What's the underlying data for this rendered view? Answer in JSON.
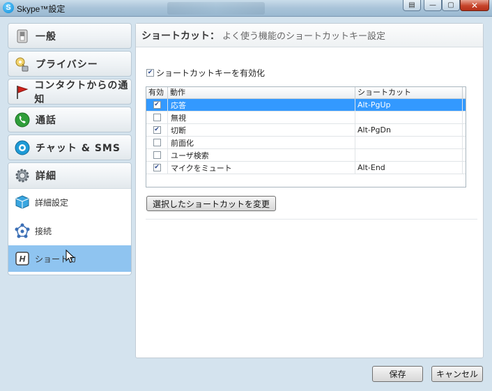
{
  "window": {
    "title": "Skype™設定",
    "app_icon_letter": "S",
    "controls": {
      "help": "▤",
      "minimize": "—",
      "maximize": "▢",
      "close": "✕"
    }
  },
  "sidebar": {
    "items": [
      {
        "label": "一般",
        "icon": "switch-icon"
      },
      {
        "label": "プライバシー",
        "icon": "key-lock-icon"
      },
      {
        "label": "コンタクトからの通知",
        "icon": "flag-icon"
      },
      {
        "label": "通話",
        "icon": "phone-icon"
      },
      {
        "label": "チャット & SMS",
        "icon": "chat-icon"
      }
    ],
    "open_section": {
      "label": "詳細",
      "icon": "gear-icon",
      "sub_items": [
        {
          "label": "詳細設定",
          "icon": "cube-icon",
          "selected": false
        },
        {
          "label": "接続",
          "icon": "network-icon",
          "selected": false
        },
        {
          "label": "ショートカ",
          "icon": "hotkey-icon",
          "selected": true
        }
      ]
    }
  },
  "content": {
    "header_title": "ショートカット：",
    "header_desc": "よく使う機能のショートカットキー設定",
    "enable_checkbox": {
      "label": "ショートカットキーを有効化",
      "checked": true
    },
    "table": {
      "columns": [
        "有効",
        "動作",
        "ショートカット"
      ],
      "rows": [
        {
          "enabled": true,
          "action": "応答",
          "shortcut": "Alt-PgUp",
          "selected": true
        },
        {
          "enabled": false,
          "action": "無視",
          "shortcut": "",
          "selected": false
        },
        {
          "enabled": true,
          "action": "切断",
          "shortcut": "Alt-PgDn",
          "selected": false
        },
        {
          "enabled": false,
          "action": "前面化",
          "shortcut": "",
          "selected": false
        },
        {
          "enabled": false,
          "action": "ユーザ検索",
          "shortcut": "",
          "selected": false
        },
        {
          "enabled": true,
          "action": "マイクをミュート",
          "shortcut": "Alt-End",
          "selected": false
        }
      ]
    },
    "change_button": "選択したショートカットを変更"
  },
  "footer": {
    "save": "保存",
    "cancel": "キャンセル"
  },
  "colors": {
    "selection": "#3399ff",
    "sidebar_selected": "#8fc4f0",
    "close_button": "#c7452b"
  }
}
